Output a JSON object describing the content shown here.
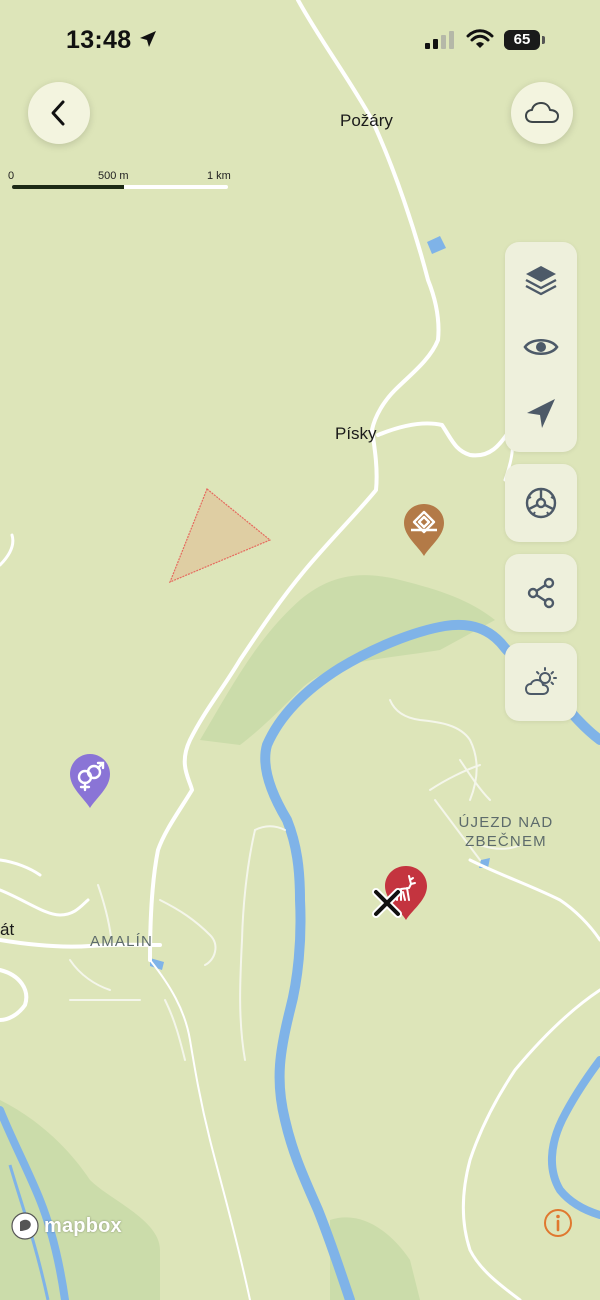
{
  "status_bar": {
    "time": "13:48",
    "battery_level": 65,
    "icons": [
      "location-arrow-icon",
      "cellular-signal-icon",
      "wifi-icon",
      "battery-icon"
    ]
  },
  "top_controls": {
    "back_icon": "chevron-left-icon",
    "offline_icon": "cloud-icon"
  },
  "scale_bar": {
    "labels": [
      "0",
      "500 m",
      "1 km"
    ]
  },
  "map": {
    "place_labels": [
      "Požáry",
      "Písky",
      "át"
    ],
    "village_labels": [
      "AMALÍN",
      "ÚJEZD NAD",
      "ZBEČNEM"
    ],
    "colors": {
      "land": "#dde5b9",
      "forest": "#cbdcaa",
      "water": "#7fb3e8",
      "road": "#ffffff"
    },
    "markers": [
      {
        "name": "lookout-tower-pin",
        "color": "#b37a47"
      },
      {
        "name": "toilets-pin",
        "color": "#8a74d6"
      },
      {
        "name": "hunting-deer-pin",
        "color": "#c4343f"
      }
    ],
    "selected_area_color": "#e89a70"
  },
  "side_panel": {
    "icons": [
      "layers-icon",
      "eye-icon",
      "navigation-arrow-icon",
      "steering-wheel-icon",
      "share-icon",
      "weather-icon"
    ]
  },
  "footer": {
    "attribution": "mapbox",
    "info_icon": "info-icon"
  }
}
